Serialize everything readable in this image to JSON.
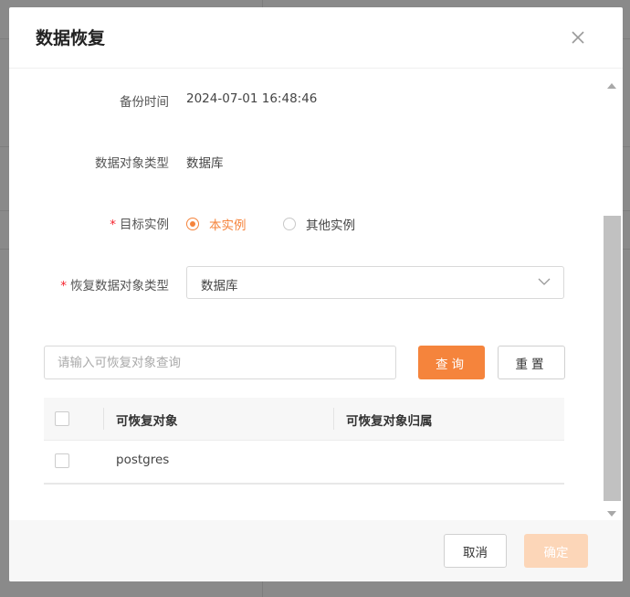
{
  "dialog": {
    "title": "数据恢复"
  },
  "form": {
    "backup_time_label": "备份时间",
    "backup_time_value": "2024-07-01 16:48:46",
    "object_type_label": "数据对象类型",
    "object_type_value": "数据库",
    "target_instance_label": "目标实例",
    "target_instance_options": [
      "本实例",
      "其他实例"
    ],
    "target_instance_selected": "本实例",
    "restore_type_label": "恢复数据对象类型",
    "restore_type_value": "数据库"
  },
  "search": {
    "placeholder": "请输入可恢复对象查询",
    "query_label": "查询",
    "reset_label": "重置"
  },
  "table": {
    "columns": [
      "可恢复对象",
      "可恢复对象归属"
    ],
    "rows": [
      {
        "object": "postgres",
        "owner": ""
      }
    ]
  },
  "footer": {
    "cancel_label": "取消",
    "confirm_label": "确定"
  },
  "colors": {
    "accent": "#f5843c",
    "required": "#f5222d",
    "confirm_disabled": "#fcd6b8"
  }
}
